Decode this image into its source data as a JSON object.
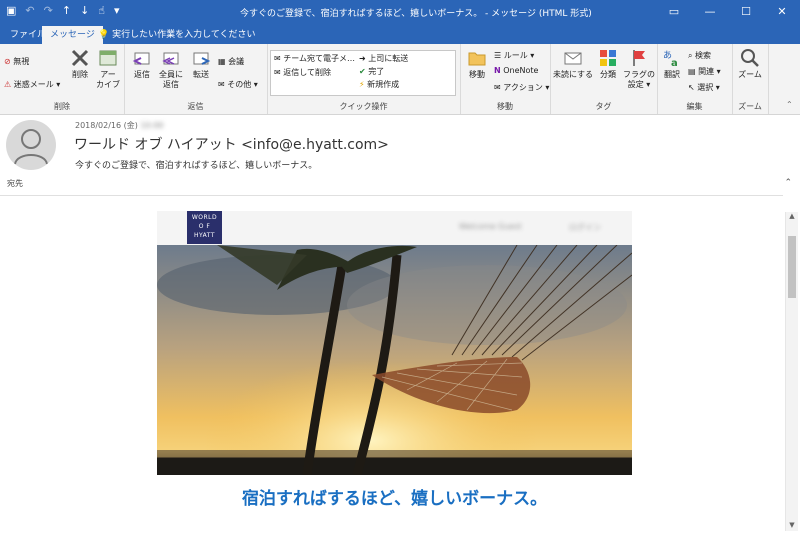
{
  "window": {
    "title": "今すぐのご登録で、宿泊すればするほど、嬉しいボーナス。 - メッセージ (HTML 形式)"
  },
  "tabs": {
    "file": "ファイル",
    "message": "メッセージ"
  },
  "tellme": "実行したい作業を入力してください",
  "ribbon": {
    "delete": {
      "ignore": "無視",
      "junk": "迷惑メール ▾",
      "delete": "削除",
      "archive_1": "アー",
      "archive_2": "カイブ",
      "label": "削除"
    },
    "respond": {
      "reply": "返信",
      "reply_all_1": "全員に",
      "reply_all_2": "返信",
      "forward": "転送",
      "meeting": "会議",
      "more": "その他 ▾",
      "label": "返信"
    },
    "quick": {
      "item1": "チーム宛て電子メ…",
      "item2": "返信して削除",
      "item3": "上司に転送",
      "item4": "完了",
      "item5": "新規作成",
      "label": "クイック操作"
    },
    "move": {
      "move": "移動",
      "rules": "ルール ▾",
      "onenote": "OneNote",
      "actions": "アクション ▾",
      "label": "移動"
    },
    "tags": {
      "unread": "未読にする",
      "categorize": "分類",
      "flag_1": "フラグの",
      "flag_2": "設定 ▾",
      "label": "タグ"
    },
    "edit": {
      "translate": "翻訳",
      "search": "検索",
      "related": "関連 ▾",
      "select": "選択 ▾",
      "label": "編集"
    },
    "zoom": {
      "zoom": "ズーム",
      "label": "ズーム"
    }
  },
  "message": {
    "date": "2018/02/16 (金)",
    "time": "10:00",
    "sender": "ワールド オブ ハイアット <info@e.hyatt.com>",
    "subject": "今すぐのご登録で、宿泊すればするほど、嬉しいボーナス。",
    "to_label": "宛先"
  },
  "email_body": {
    "logo_lines": [
      "WORLD",
      "O F",
      "HYATT"
    ],
    "nav1": "Welcome Guest",
    "nav2": "ログイン",
    "headline": "宿泊すればするほど、嬉しいボーナス。"
  },
  "colors": {
    "titlebar": "#2b65b7",
    "headline": "#1a6fc2",
    "logo_bg": "#2a2f6b"
  }
}
